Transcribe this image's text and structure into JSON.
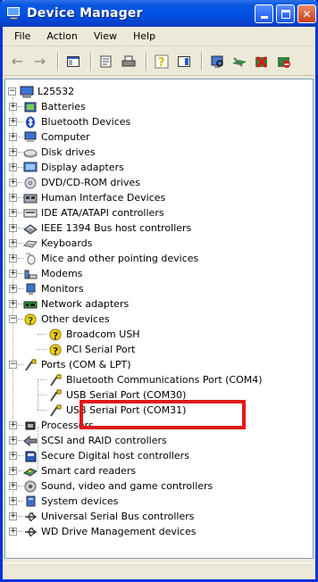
{
  "window": {
    "title": "Device Manager"
  },
  "menu": [
    "File",
    "Action",
    "View",
    "Help"
  ],
  "toolbar": [
    "back-icon",
    "forward-icon",
    "show-hide-console-tree-icon",
    "properties-icon",
    "print-icon",
    "help-icon",
    "export-icon",
    "scan-hardware-icon",
    "update-driver-icon",
    "uninstall-icon",
    "disable-icon"
  ],
  "tree": {
    "root": "L25532",
    "items": [
      {
        "label": "Batteries",
        "icon": "battery-icon"
      },
      {
        "label": "Bluetooth Devices",
        "icon": "bluetooth-icon"
      },
      {
        "label": "Computer",
        "icon": "computer-icon"
      },
      {
        "label": "Disk drives",
        "icon": "disk-drive-icon"
      },
      {
        "label": "Display adapters",
        "icon": "display-adapter-icon"
      },
      {
        "label": "DVD/CD-ROM drives",
        "icon": "dvd-drive-icon"
      },
      {
        "label": "Human Interface Devices",
        "icon": "hid-icon"
      },
      {
        "label": "IDE ATA/ATAPI controllers",
        "icon": "ide-controller-icon"
      },
      {
        "label": "IEEE 1394 Bus host controllers",
        "icon": "ieee1394-icon"
      },
      {
        "label": "Keyboards",
        "icon": "keyboard-icon"
      },
      {
        "label": "Mice and other pointing devices",
        "icon": "mouse-icon"
      },
      {
        "label": "Modems",
        "icon": "modem-icon"
      },
      {
        "label": "Monitors",
        "icon": "monitor-icon"
      },
      {
        "label": "Network adapters",
        "icon": "network-adapter-icon"
      },
      {
        "label": "Other devices",
        "icon": "unknown-device-icon"
      },
      {
        "label": "Broadcom USH",
        "icon": "warning-device-icon"
      },
      {
        "label": "PCI Serial Port",
        "icon": "warning-device-icon"
      },
      {
        "label": "Ports (COM & LPT)",
        "icon": "port-icon"
      },
      {
        "label": "Bluetooth Communications Port (COM4)",
        "icon": "port-icon"
      },
      {
        "label": "USB Serial Port (COM30)",
        "icon": "port-icon"
      },
      {
        "label": "USB Serial Port (COM31)",
        "icon": "port-icon"
      },
      {
        "label": "Processors",
        "icon": "processor-icon"
      },
      {
        "label": "SCSI and RAID controllers",
        "icon": "scsi-icon"
      },
      {
        "label": "Secure Digital host controllers",
        "icon": "sd-host-icon"
      },
      {
        "label": "Smart card readers",
        "icon": "smart-card-icon"
      },
      {
        "label": "Sound, video and game controllers",
        "icon": "sound-icon"
      },
      {
        "label": "System devices",
        "icon": "system-device-icon"
      },
      {
        "label": "Universal Serial Bus controllers",
        "icon": "usb-icon"
      },
      {
        "label": "WD Drive Management devices",
        "icon": "wd-drive-icon"
      }
    ]
  },
  "colors": {
    "titlebar": "#0054e3",
    "highlight_box": "#e01818",
    "warning": "#f5d20a"
  }
}
